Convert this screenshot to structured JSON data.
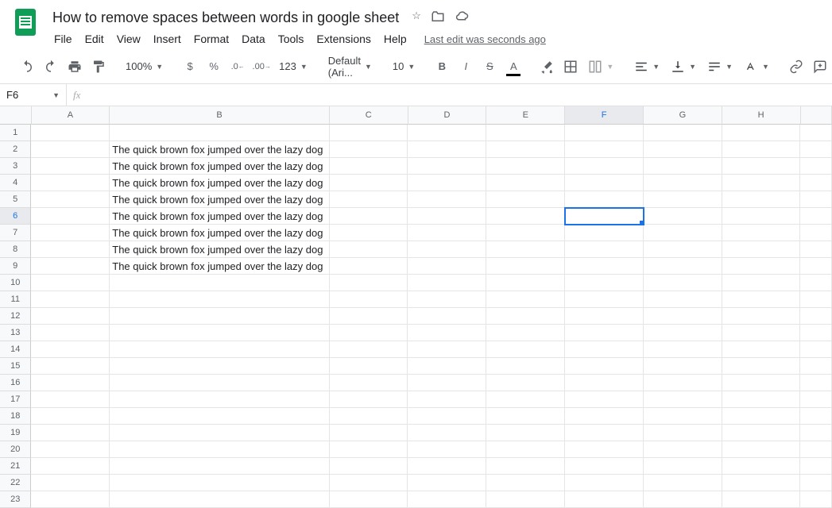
{
  "doc": {
    "title": "How to remove spaces between words in google sheet"
  },
  "menu": {
    "file": "File",
    "edit": "Edit",
    "view": "View",
    "insert": "Insert",
    "format": "Format",
    "data": "Data",
    "tools": "Tools",
    "extensions": "Extensions",
    "help": "Help",
    "last_edit": "Last edit was seconds ago"
  },
  "toolbar": {
    "zoom": "100%",
    "font": "Default (Ari...",
    "font_size": "10",
    "currency": "$",
    "percent": "%",
    "dec_dec": ".0",
    "inc_dec": ".00",
    "more_formats": "123"
  },
  "namebox": {
    "value": "F6",
    "fx": "fx"
  },
  "grid": {
    "columns": [
      "A",
      "B",
      "C",
      "D",
      "E",
      "F",
      "G",
      "H"
    ],
    "row_count": 23,
    "selected": {
      "row": 6,
      "col": "F"
    },
    "cells": {
      "B2": "The quick brown fox jumped over the lazy dog",
      "B3": "The quick brown fox jumped over the lazy dog",
      "B4": "The quick brown fox jumped over the lazy dog",
      "B5": "The quick brown fox jumped over the lazy dog",
      "B6": "The quick brown fox jumped over the lazy dog",
      "B7": "The quick brown fox jumped over the lazy dog",
      "B8": "The quick brown fox jumped over the lazy dog",
      "B9": "The quick brown fox jumped over the lazy dog"
    }
  }
}
